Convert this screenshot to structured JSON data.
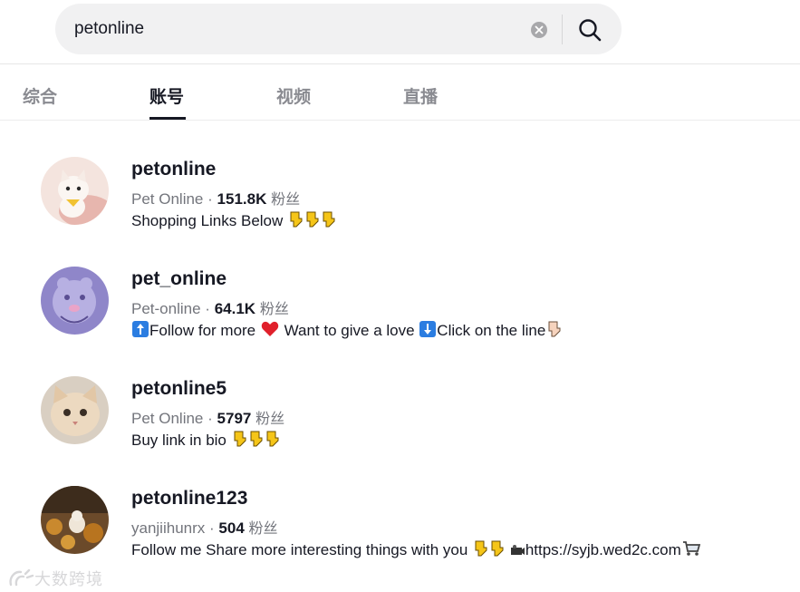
{
  "search": {
    "query": "petonline"
  },
  "tabs": [
    {
      "label": "综合",
      "active": false
    },
    {
      "label": "账号",
      "active": true
    },
    {
      "label": "视频",
      "active": false
    },
    {
      "label": "直播",
      "active": false
    }
  ],
  "users": [
    {
      "username": "petonline",
      "nickname": "Pet Online",
      "followers": "151.8K",
      "followers_suffix": "粉丝",
      "bio_parts": [
        "Shopping Links Below"
      ]
    },
    {
      "username": "pet_online",
      "nickname": "Pet-online",
      "followers": "64.1K",
      "followers_suffix": "粉丝",
      "bio_parts": [
        "Follow for more",
        "Want to give a love",
        "Click on the line"
      ]
    },
    {
      "username": "petonline5",
      "nickname": "Pet Online",
      "followers": "5797",
      "followers_suffix": "粉丝",
      "bio_parts": [
        "Buy link in bio"
      ]
    },
    {
      "username": "petonline123",
      "nickname": "yanjiihunrx",
      "followers": "504",
      "followers_suffix": "粉丝",
      "bio_parts": [
        "Follow me Share more interesting things with you",
        "https://syjb.wed2c.com"
      ]
    }
  ],
  "separator": "·",
  "watermark": "大数跨境",
  "colors": {
    "accent": "#161823",
    "muted": "#73757c",
    "search_bg": "#f1f1f2"
  }
}
